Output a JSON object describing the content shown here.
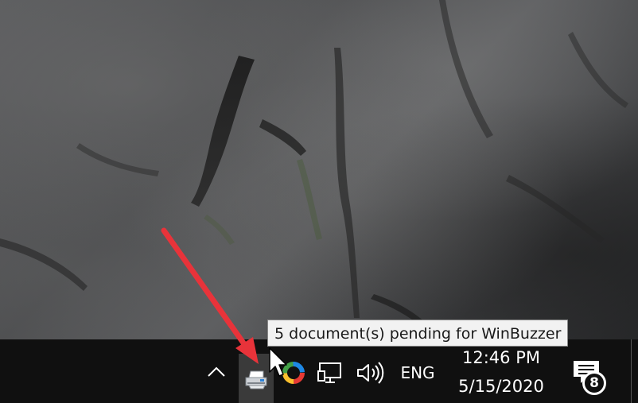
{
  "tooltip": {
    "text": "5 document(s) pending for WinBuzzer"
  },
  "taskbar": {
    "language": "ENG",
    "clock": {
      "time": "12:46 PM",
      "date": "5/15/2020"
    },
    "notifications": {
      "count": "8"
    },
    "tray_icons": [
      "chevron-up-icon",
      "printer-icon",
      "colorful-ring-app-icon",
      "network-icon",
      "volume-icon"
    ]
  },
  "colors": {
    "taskbar_bg": "#101010",
    "tooltip_bg": "#f2f2f2",
    "annotation_arrow": "#e8333a",
    "printer_hover_bg": "#3a3a3a"
  }
}
